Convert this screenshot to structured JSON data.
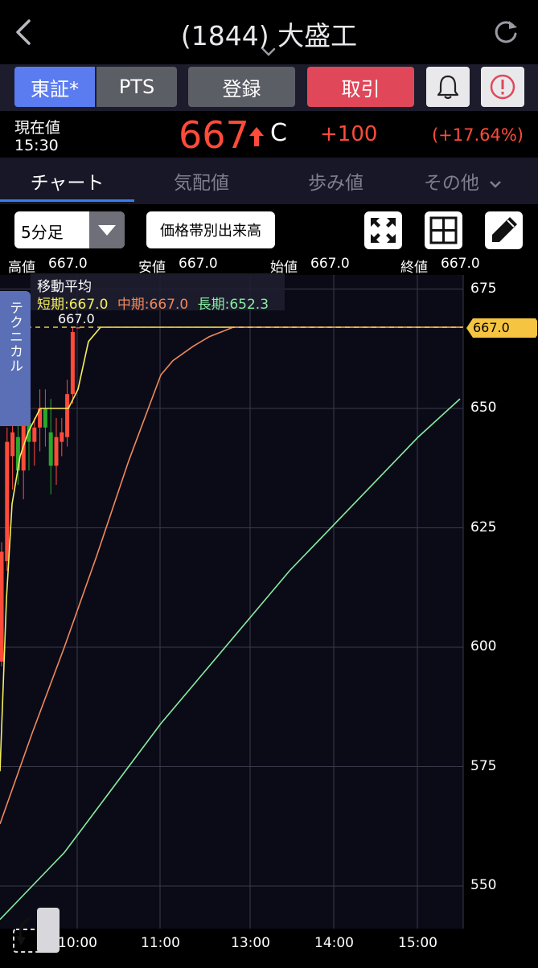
{
  "header": {
    "title": "(1844) 大盛工"
  },
  "buttons": {
    "market_tse": "東証*",
    "market_pts": "PTS",
    "register": "登録",
    "trade": "取引"
  },
  "quote": {
    "label_current": "現在値",
    "time": "15:30",
    "price": "667",
    "flag": "C",
    "change": "+100",
    "change_pct": "(+17.64%)"
  },
  "tabs": [
    "チャート",
    "気配値",
    "歩み値",
    "その他"
  ],
  "toolbar": {
    "interval": "5分足",
    "price_volume_button": "価格帯別出来高"
  },
  "ohlc": {
    "high_label": "高値",
    "high": "667.0",
    "low_label": "安値",
    "low": "667.0",
    "open_label": "始値",
    "open": "667.0",
    "close_label": "終値",
    "close": "667.0"
  },
  "technical_tab": "テクニカル",
  "moving_average": {
    "title": "移動平均",
    "short": "短期:667.0",
    "mid": "中期:667.0",
    "long": "長期:652.3"
  },
  "colors": {
    "up": "#ff4b3a",
    "down": "#29a82a",
    "short": "#f4ef5d",
    "mid": "#f0895a",
    "long": "#88eea0",
    "accent": "#5b7cf0"
  },
  "chart_data": {
    "type": "line",
    "title": "",
    "xlabel": "",
    "ylabel": "",
    "y_ticks": [
      "675",
      "650",
      "625",
      "600",
      "575",
      "550"
    ],
    "x_ticks": [
      "10:00",
      "11:00",
      "12:00",
      "13:00",
      "14:00",
      "15:00"
    ],
    "ylim": [
      541,
      677
    ],
    "current_price_tag": "667.0",
    "peak_annotation": "667.0",
    "candles": [
      {
        "o": 597,
        "h": 622,
        "l": 596,
        "c": 620
      },
      {
        "o": 618,
        "h": 646,
        "l": 616,
        "c": 643
      },
      {
        "o": 640,
        "h": 650,
        "l": 633,
        "c": 645
      },
      {
        "o": 644,
        "h": 648,
        "l": 634,
        "c": 637
      },
      {
        "o": 637,
        "h": 651,
        "l": 631,
        "c": 648
      },
      {
        "o": 647,
        "h": 652,
        "l": 637,
        "c": 643
      },
      {
        "o": 643,
        "h": 648,
        "l": 638,
        "c": 646
      },
      {
        "o": 646,
        "h": 654,
        "l": 641,
        "c": 650
      },
      {
        "o": 650,
        "h": 654,
        "l": 642,
        "c": 646
      },
      {
        "o": 645,
        "h": 652,
        "l": 632,
        "c": 638
      },
      {
        "o": 638,
        "h": 648,
        "l": 634,
        "c": 644
      },
      {
        "o": 643,
        "h": 648,
        "l": 640,
        "c": 645
      },
      {
        "o": 644,
        "h": 656,
        "l": 642,
        "c": 653
      },
      {
        "o": 653,
        "h": 667,
        "l": 651,
        "c": 666
      },
      {
        "o": 667,
        "h": 667,
        "l": 667,
        "c": 667
      }
    ],
    "series": [
      {
        "name": "短期",
        "points": [
          [
            0,
            574
          ],
          [
            8,
            610
          ],
          [
            15,
            630
          ],
          [
            25,
            640
          ],
          [
            35,
            645
          ],
          [
            50,
            650
          ],
          [
            70,
            650
          ],
          [
            85,
            650
          ],
          [
            97,
            654
          ],
          [
            110,
            664
          ],
          [
            125,
            667
          ],
          [
            575,
            667
          ]
        ]
      },
      {
        "name": "中期",
        "points": [
          [
            0,
            563
          ],
          [
            40,
            582
          ],
          [
            80,
            600
          ],
          [
            120,
            619
          ],
          [
            160,
            639
          ],
          [
            200,
            657
          ],
          [
            215,
            660
          ],
          [
            240,
            663
          ],
          [
            260,
            665
          ],
          [
            290,
            667
          ],
          [
            300,
            667
          ],
          [
            575,
            667
          ]
        ]
      },
      {
        "name": "長期",
        "points": [
          [
            0,
            543
          ],
          [
            40,
            550
          ],
          [
            80,
            557
          ],
          [
            120,
            566
          ],
          [
            160,
            575
          ],
          [
            200,
            584
          ],
          [
            240,
            592
          ],
          [
            280,
            600
          ],
          [
            320,
            608
          ],
          [
            360,
            616
          ],
          [
            400,
            623
          ],
          [
            440,
            630
          ],
          [
            480,
            637
          ],
          [
            520,
            644
          ],
          [
            572,
            652
          ]
        ]
      }
    ]
  }
}
